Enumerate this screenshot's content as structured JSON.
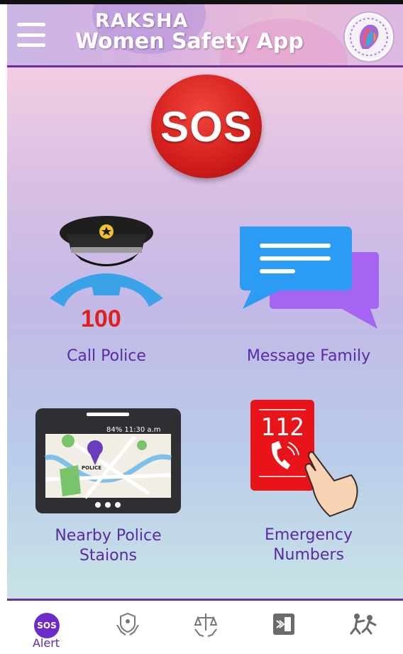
{
  "header": {
    "title_line1": "RAKSHA",
    "title_line2": "Women Safety App",
    "menu_icon": "hamburger-menu-icon",
    "logo_icon": "women-face-logo-icon"
  },
  "sos_button": {
    "label": "SOS",
    "color": "#d6201d"
  },
  "tiles": {
    "call_police": {
      "label": "Call Police",
      "number": "100",
      "icon": "police-cap-phone-icon"
    },
    "message_family": {
      "label": "Message Family",
      "icon": "chat-bubbles-icon"
    },
    "nearby_police": {
      "label_line1": "Nearby Police",
      "label_line2": "Staions",
      "icon": "tablet-map-icon",
      "status_text": "84%  11:30 a.m",
      "map_pin_label": "POLICE"
    },
    "emergency_numbers": {
      "label_line1": "Emergency",
      "label_line2": "Numbers",
      "number": "112",
      "icon": "emergency-phone-card-icon"
    }
  },
  "bottom_nav": {
    "items": [
      {
        "badge": "SOS",
        "label": "Alert",
        "icon": "sos-alert-icon",
        "active": true
      },
      {
        "label": "",
        "icon": "protection-hands-icon"
      },
      {
        "label": "",
        "icon": "law-scales-icon"
      },
      {
        "label": "",
        "icon": "exit-door-icon"
      },
      {
        "label": "",
        "icon": "self-defense-icon"
      }
    ]
  },
  "colors": {
    "accent": "#6b2f9a",
    "label": "#5a2aa8",
    "sos": "#d6201d"
  }
}
